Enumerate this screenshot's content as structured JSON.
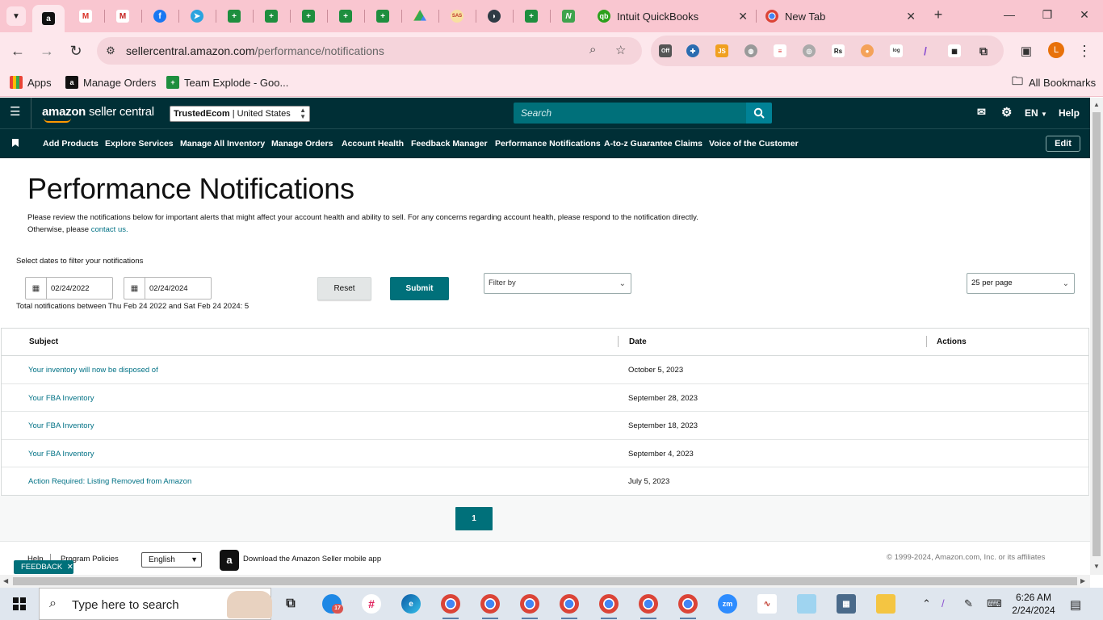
{
  "browser": {
    "tabs": [
      {
        "label": "Intuit QuickBooks"
      },
      {
        "label": "New Tab"
      }
    ],
    "url_host": "sellercentral.amazon.com",
    "url_path": "/performance/notifications",
    "bookmarks": [
      "Apps",
      "Manage Orders",
      "Team Explode - Goo..."
    ],
    "all_bookmarks": "All Bookmarks",
    "profile_initial": "L",
    "extension_badge": "Off"
  },
  "header": {
    "logo_brand": "amazon",
    "logo_product": "seller central",
    "store_bold": "TrustedEcom",
    "store_rest": "| United States",
    "search_placeholder": "Search",
    "language": "EN",
    "help": "Help"
  },
  "nav": {
    "items": [
      "Add Products",
      "Explore Services",
      "Manage All Inventory",
      "Manage Orders",
      "Account Health",
      "Feedback Manager",
      "Performance Notifications",
      "A-to-z Guarantee Claims",
      "Voice of the Customer"
    ],
    "edit": "Edit"
  },
  "main": {
    "title": "Performance Notifications",
    "intro": "Please review the notifications below for important alerts that might affect your account health and ability to sell. For any concerns regarding account health, please respond to the notification directly. Otherwise, please",
    "intro_link": "contact us.",
    "filter_label": "Select dates to filter your notifications",
    "date_from": "02/24/2022",
    "date_to": "02/24/2024",
    "reset": "Reset",
    "submit": "Submit",
    "filter_by": "Filter by",
    "per_page": "25 per page",
    "total": "Total notifications between Thu Feb 24 2022 and Sat Feb 24 2024: 5"
  },
  "table": {
    "headers": {
      "subject": "Subject",
      "date": "Date",
      "actions": "Actions"
    },
    "rows": [
      {
        "subject": "Your inventory will now be disposed of",
        "date": "October 5, 2023"
      },
      {
        "subject": "Your FBA Inventory",
        "date": "September 28, 2023"
      },
      {
        "subject": "Your FBA Inventory",
        "date": "September 18, 2023"
      },
      {
        "subject": "Your FBA Inventory",
        "date": "September 4, 2023"
      },
      {
        "subject": "Action Required: Listing Removed from Amazon",
        "date": "July 5, 2023"
      }
    ]
  },
  "pagination": {
    "current": "1"
  },
  "footer": {
    "help": "Help",
    "policies": "Program Policies",
    "language": "English",
    "app_text": "Download the Amazon Seller mobile app",
    "copyright": "© 1999-2024, Amazon.com, Inc. or its affiliates",
    "feedback": "FEEDBACK"
  },
  "taskbar": {
    "search_placeholder": "Type here to search",
    "time": "6:26 AM",
    "date": "2/24/2024",
    "mail_badge": "17"
  },
  "colors": {
    "header_bg": "#002f36",
    "accent": "#00707a",
    "link": "#007185",
    "chrome_tab_bg": "#f9c6d0"
  }
}
